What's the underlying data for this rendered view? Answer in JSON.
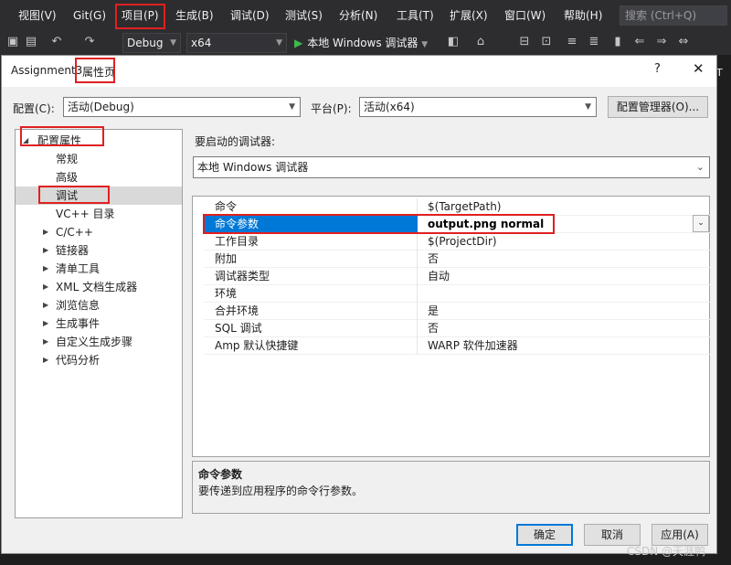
{
  "menubar": {
    "items": [
      "视图(V)",
      "Git(G)",
      "项目(P)",
      "生成(B)",
      "调试(D)",
      "测试(S)",
      "分析(N)",
      "工具(T)",
      "扩展(X)",
      "窗口(W)",
      "帮助(H)"
    ],
    "search_placeholder": "搜索 (Ctrl+Q)"
  },
  "toolbar": {
    "config": "Debug",
    "platform": "x64",
    "start": "本地 Windows 调试器"
  },
  "side_tab": "T",
  "dialog": {
    "title": "Assignment3",
    "title_page": "属性页",
    "help": "?",
    "close": "✕",
    "config_label": "配置(C):",
    "config_value": "活动(Debug)",
    "platform_label": "平台(P):",
    "platform_value": "活动(x64)",
    "config_manager": "配置管理器(O)...",
    "debugger_label": "要启动的调试器:",
    "debugger_value": "本地 Windows 调试器",
    "tree": [
      {
        "label": "配置属性",
        "expander": "◢"
      },
      {
        "label": "常规",
        "expander": ""
      },
      {
        "label": "高级",
        "expander": ""
      },
      {
        "label": "调试",
        "expander": ""
      },
      {
        "label": "VC++ 目录",
        "expander": ""
      },
      {
        "label": "C/C++",
        "expander": "▶"
      },
      {
        "label": "链接器",
        "expander": "▶"
      },
      {
        "label": "清单工具",
        "expander": "▶"
      },
      {
        "label": "XML 文档生成器",
        "expander": "▶"
      },
      {
        "label": "浏览信息",
        "expander": "▶"
      },
      {
        "label": "生成事件",
        "expander": "▶"
      },
      {
        "label": "自定义生成步骤",
        "expander": "▶"
      },
      {
        "label": "代码分析",
        "expander": "▶"
      }
    ],
    "grid": [
      {
        "name": "命令",
        "value": "$(TargetPath)"
      },
      {
        "name": "命令参数",
        "value": "output.png normal"
      },
      {
        "name": "工作目录",
        "value": "$(ProjectDir)"
      },
      {
        "name": "附加",
        "value": "否"
      },
      {
        "name": "调试器类型",
        "value": "自动"
      },
      {
        "name": "环境",
        "value": ""
      },
      {
        "name": "合并环境",
        "value": "是"
      },
      {
        "name": "SQL 调试",
        "value": "否"
      },
      {
        "name": "Amp 默认快捷键",
        "value": "WARP 软件加速器"
      }
    ],
    "desc_title": "命令参数",
    "desc_text": "要传递到应用程序的命令行参数。",
    "ok": "确定",
    "cancel": "取消",
    "apply": "应用(A)"
  },
  "watermark": "CSDN @天涯鸭"
}
